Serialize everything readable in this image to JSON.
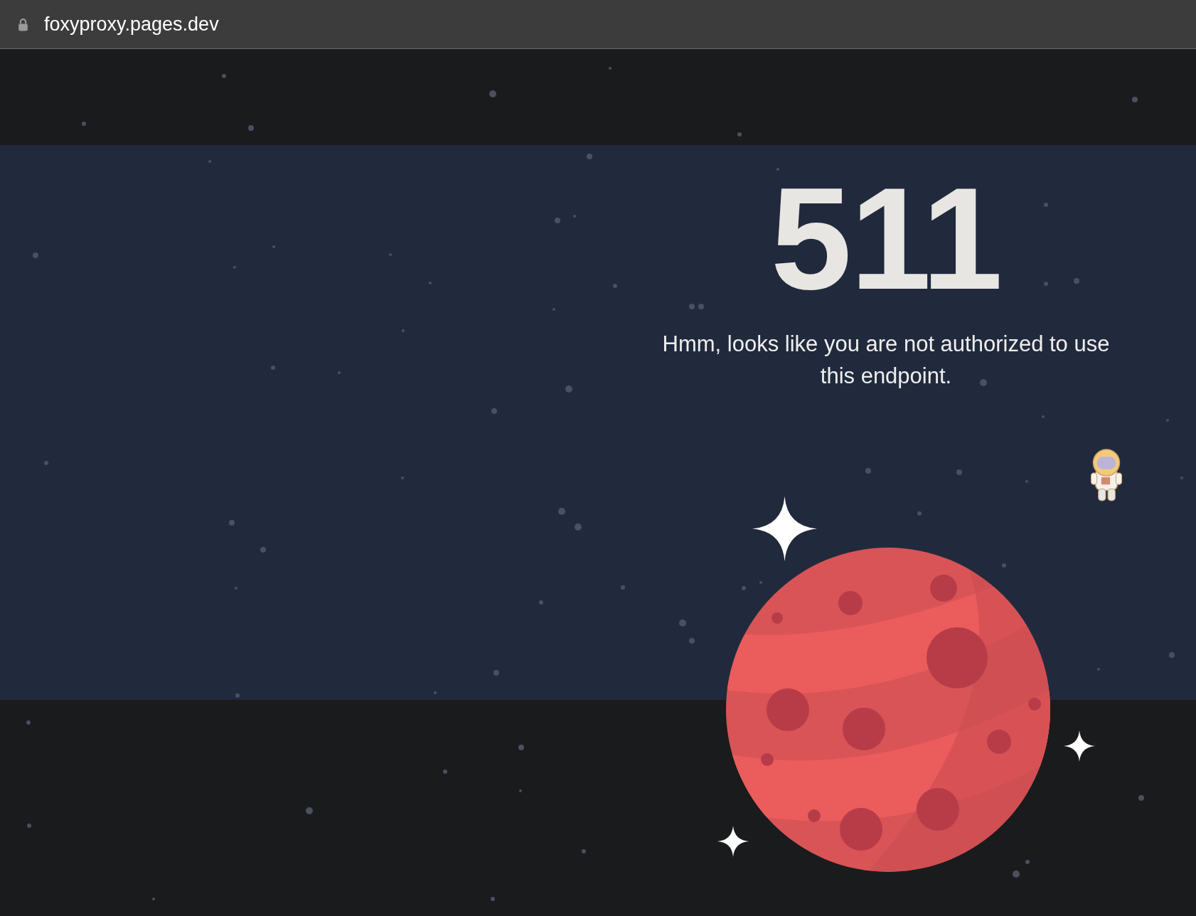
{
  "browser": {
    "url": "foxyproxy.pages.dev"
  },
  "error": {
    "code": "511",
    "message": "Hmm, looks like you are not authorized to use this endpoint."
  }
}
